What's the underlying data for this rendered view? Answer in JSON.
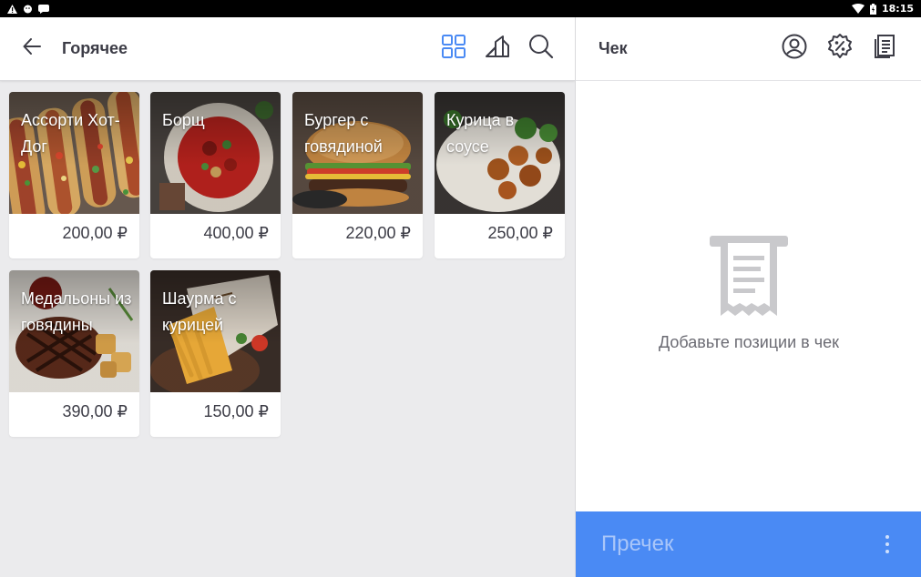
{
  "status_bar": {
    "time": "18:15"
  },
  "left": {
    "title": "Горячее",
    "products": [
      {
        "name": "Ассорти Хот-Дог",
        "price": "200,00 ₽",
        "image_theme": "hotdog"
      },
      {
        "name": "Борщ",
        "price": "400,00 ₽",
        "image_theme": "borscht"
      },
      {
        "name": "Бургер с говядиной",
        "price": "220,00 ₽",
        "image_theme": "burger"
      },
      {
        "name": "Курица в соусе",
        "price": "250,00 ₽",
        "image_theme": "chicken"
      },
      {
        "name": "Медальоны из говядины",
        "price": "390,00 ₽",
        "image_theme": "steak"
      },
      {
        "name": "Шаурма с курицей",
        "price": "150,00 ₽",
        "image_theme": "shawarma"
      }
    ]
  },
  "right": {
    "title": "Чек",
    "empty_text": "Добавьте позиции в чек",
    "precheck_label": "Пречек"
  },
  "colors": {
    "accent_blue": "#4a8af4",
    "grid_icon_blue": "#4a8af4",
    "text_dark": "#3c3c46",
    "panel_gray": "#ebebed"
  },
  "icons": {
    "back": "arrow-left-icon",
    "grid": "grid-view-icon",
    "categories": "category-shapes-icon",
    "search": "search-icon",
    "customer": "user-circle-icon",
    "discount": "discount-badge-icon",
    "receipts": "receipt-list-icon",
    "empty_receipt": "receipt-icon",
    "more": "more-vertical-icon"
  }
}
